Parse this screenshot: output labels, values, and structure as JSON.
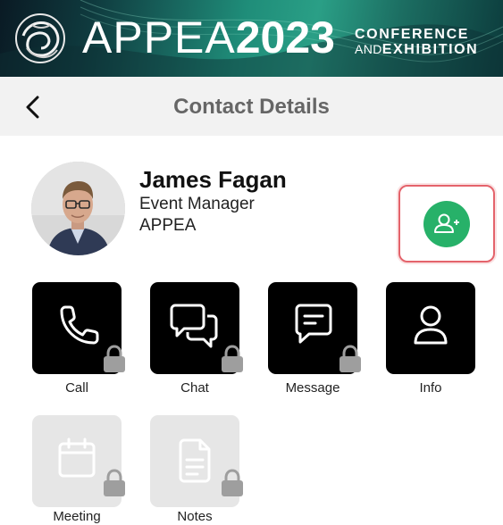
{
  "banner": {
    "word": "APPEA",
    "year": "2023",
    "conference": "CONFERENCE",
    "and": "AND",
    "exhibition": "EXHIBITION"
  },
  "header": {
    "title": "Contact Details",
    "back_icon": "chevron-left-icon"
  },
  "contact": {
    "name": "James Fagan",
    "role": "Event Manager",
    "organization": "APPEA",
    "add_contact_icon": "add-user-icon"
  },
  "actions": [
    {
      "label": "Call",
      "icon": "phone-icon",
      "locked": true,
      "enabled": true
    },
    {
      "label": "Chat",
      "icon": "chat-bubbles-icon",
      "locked": true,
      "enabled": true
    },
    {
      "label": "Message",
      "icon": "message-icon",
      "locked": true,
      "enabled": true
    },
    {
      "label": "Info",
      "icon": "person-icon",
      "locked": false,
      "enabled": true
    },
    {
      "label": "Meeting",
      "icon": "calendar-icon",
      "locked": true,
      "enabled": false
    },
    {
      "label": "Notes",
      "icon": "document-icon",
      "locked": true,
      "enabled": false
    }
  ],
  "colors": {
    "accent_green": "#27b169",
    "highlight_red": "#e4636b",
    "tile_active": "#000000",
    "tile_disabled": "#e6e6e6",
    "lock_gray": "#9e9e9e",
    "title_gray": "#666666"
  }
}
